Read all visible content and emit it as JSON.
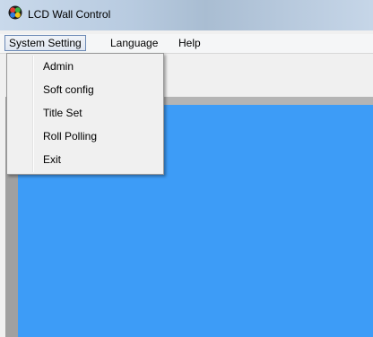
{
  "window": {
    "title": "LCD Wall Control",
    "icon": "app-icon"
  },
  "menubar": {
    "items": [
      {
        "label": "System Setting",
        "active": true
      },
      {
        "label": "Language",
        "active": false
      },
      {
        "label": "Help",
        "active": false
      }
    ]
  },
  "dropdown": {
    "items": [
      {
        "label": "Admin"
      },
      {
        "label": "Soft config"
      },
      {
        "label": "Title Set"
      },
      {
        "label": "Roll Polling"
      },
      {
        "label": "Exit"
      }
    ]
  },
  "colors": {
    "workspace": "#3d9cf7",
    "menu_active_border": "#6b89b5"
  }
}
